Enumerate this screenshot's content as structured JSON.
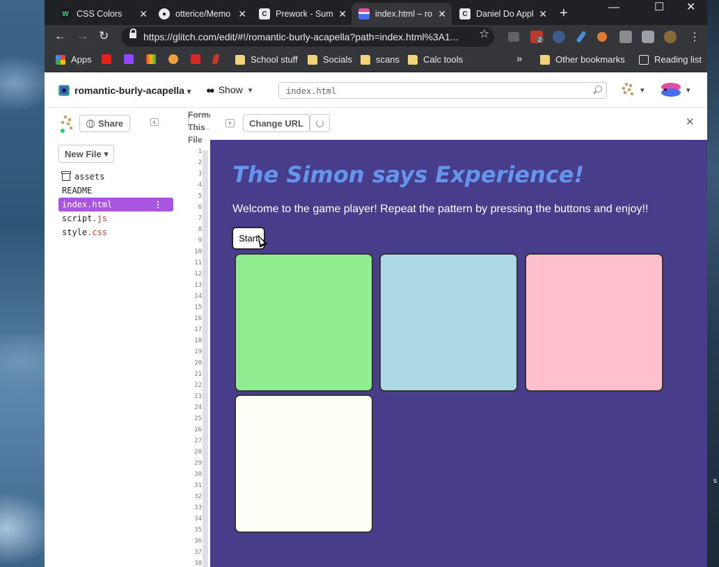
{
  "browser": {
    "tabs": [
      {
        "label": "CSS Colors",
        "favicon": "w-icon"
      },
      {
        "label": "otterice/Memo",
        "favicon": "github-icon"
      },
      {
        "label": "Prework - Sum",
        "favicon": "codepath-icon"
      },
      {
        "label": "index.html – ro",
        "favicon": "glitch-icon",
        "active": true
      },
      {
        "label": "Daniel Do Appl",
        "favicon": "codepath-icon"
      }
    ],
    "url": "https://glitch.com/edit/#!/romantic-burly-acapella?path=index.html%3A1...",
    "extension_badge": "2",
    "bookmarks": [
      {
        "label": "Apps",
        "icon": "apps-grid-icon"
      },
      {
        "label": "",
        "icon": "youtube-icon"
      },
      {
        "label": "",
        "icon": "twitch-icon"
      },
      {
        "label": "",
        "icon": "gmail-icon"
      },
      {
        "label": "",
        "icon": "pie-icon"
      },
      {
        "label": "",
        "icon": "ak-icon"
      },
      {
        "label": "",
        "icon": "h-icon"
      },
      {
        "label": "School stuff",
        "icon": "folder-icon"
      },
      {
        "label": "Socials",
        "icon": "folder-icon"
      },
      {
        "label": "scans",
        "icon": "folder-icon"
      },
      {
        "label": "Calc tools",
        "icon": "folder-icon"
      }
    ],
    "more_bookmarks": "»",
    "other_bookmarks": "Other bookmarks",
    "reading_list": "Reading list"
  },
  "glitch": {
    "project_name": "romantic-burly-acapella",
    "show_label": "Show",
    "search_value": "index.html",
    "share_label": "Share",
    "new_file_label": "New File",
    "format_label": "Format This File",
    "files": [
      {
        "base": "assets",
        "ext": "",
        "icon": "box-icon"
      },
      {
        "base": "README",
        "ext": ""
      },
      {
        "base": "index.html",
        "ext": "",
        "active": true
      },
      {
        "base": "script",
        "ext": ".js"
      },
      {
        "base": "style",
        "ext": ".css"
      }
    ],
    "line_numbers": [
      "1",
      "2",
      "3",
      "4",
      "5",
      "6",
      "7",
      "8",
      "9",
      "10",
      "11",
      "12",
      "13",
      "14",
      "15",
      "16",
      "17",
      "18",
      "19",
      "20",
      "21",
      "22",
      "23",
      "24",
      "25",
      "26",
      "27",
      "28",
      "29",
      "30",
      "31",
      "32",
      "33",
      "34",
      "35",
      "36",
      "37",
      "38"
    ],
    "change_url_label": "Change URL"
  },
  "preview": {
    "title": "The Simon says Experience!",
    "description": "Welcome to the game player! Repeat the pattern by pressing the buttons and enjoy!!",
    "start_label": "Start",
    "background": "#483d8b",
    "title_color": "#6495ed",
    "game_buttons": [
      {
        "name": "game-button-1",
        "color": "#90ee90"
      },
      {
        "name": "game-button-2",
        "color": "#add8e6"
      },
      {
        "name": "game-button-3",
        "color": "#ffc0cb"
      },
      {
        "name": "game-button-4",
        "color": "#fffff8"
      }
    ]
  },
  "desktop": {
    "edge_text": "s"
  }
}
